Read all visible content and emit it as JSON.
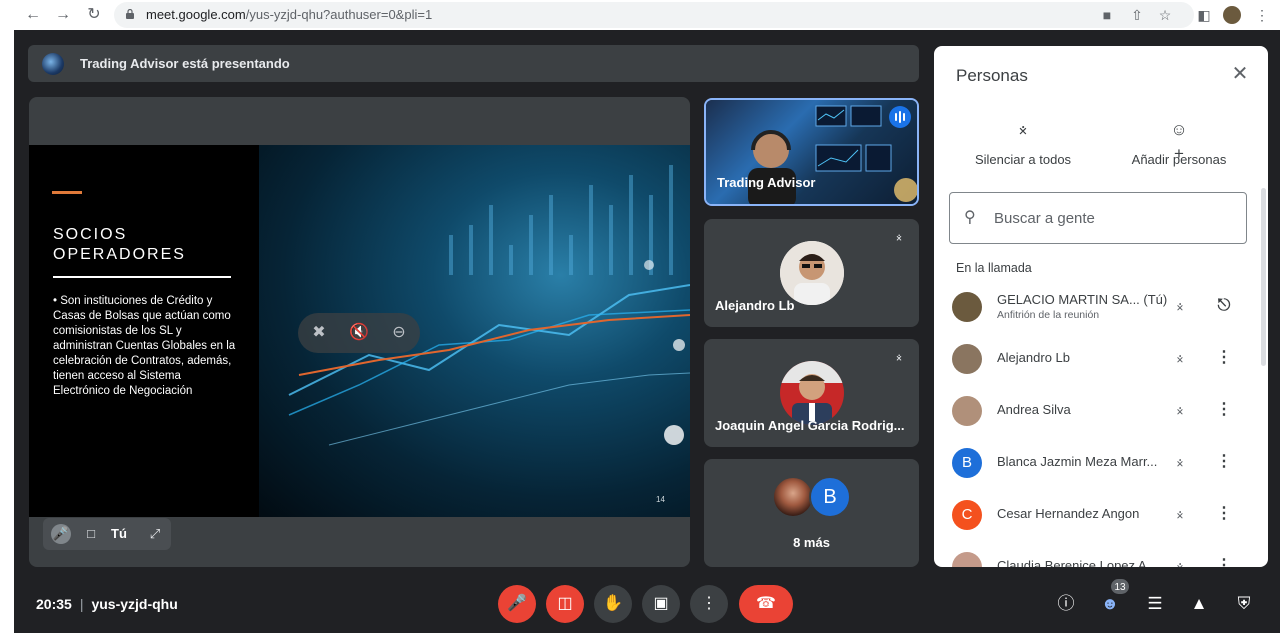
{
  "browser": {
    "url_host": "meet.google.com",
    "url_path": "/yus-yzjd-qhu?authuser=0&pli=1"
  },
  "banner": {
    "text": "Trading Advisor está presentando"
  },
  "slide": {
    "title": "SOCIOS\nOPERADORES",
    "body": "• Son instituciones de Crédito y Casas de Bolsas que actúan como comisionistas de los SL y administran Cuentas Globales en la celebración de Contratos, además, tienen acceso al Sistema Electrónico de Negociación",
    "page_number": "14"
  },
  "self_tile": {
    "label": "Tú"
  },
  "tiles": [
    {
      "name": "Trading Advisor"
    },
    {
      "name": "Alejandro Lb"
    },
    {
      "name": "Joaquin Angel Garcia Rodrig..."
    },
    {
      "name": "8 más",
      "avatar_letter": "B"
    }
  ],
  "panel": {
    "title": "Personas",
    "mute_all": "Silenciar a todos",
    "add_people": "Añadir personas",
    "search_placeholder": "Buscar a gente",
    "section_label": "En la llamada",
    "participants": [
      {
        "name": "GELACIO MARTIN SA... (Tú)",
        "sub": "Anfitrión de la reunión",
        "avatar_color": "#6b5a3e"
      },
      {
        "name": "Alejandro Lb",
        "avatar_color": "#8a7560"
      },
      {
        "name": "Andrea Silva",
        "avatar_color": "#b0907a"
      },
      {
        "name": "Blanca Jazmin Meza Marr...",
        "avatar_letter": "B",
        "avatar_color": "#1e6fd9"
      },
      {
        "name": "Cesar Hernandez Angon",
        "avatar_letter": "C",
        "avatar_color": "#f4511e"
      },
      {
        "name": "Claudia Berenice Lopez A...",
        "avatar_color": "#c49a8a"
      }
    ]
  },
  "bottom": {
    "time": "20:35",
    "meeting_code": "yus-yzjd-qhu",
    "people_count": "13"
  },
  "colors": {
    "accent": "#8ab4f8",
    "danger": "#ea4335",
    "surface": "#3c4043",
    "background": "#202124"
  }
}
